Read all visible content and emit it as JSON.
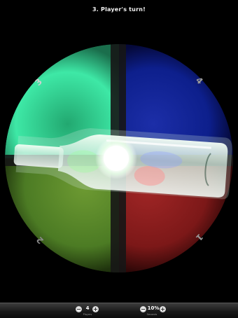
{
  "header": {
    "title": "3. Player's turn!"
  },
  "wheel": {
    "colors": {
      "teal": "#3ee8a6",
      "blue": "#0d1f8c",
      "green": "#4c7b24",
      "red": "#7c1818",
      "divider": "#1a1a1a"
    },
    "labels": {
      "top_left": "3",
      "top_right": "4",
      "bottom_left": "2",
      "bottom_right": "1"
    }
  },
  "bottle": {
    "state": "spinning"
  },
  "controls": {
    "players": {
      "value": "4",
      "caption": "Players",
      "minus": "−",
      "plus": "+"
    },
    "seconds": {
      "value": "10%",
      "caption": "Seconds",
      "minus": "−",
      "plus": "+"
    }
  }
}
